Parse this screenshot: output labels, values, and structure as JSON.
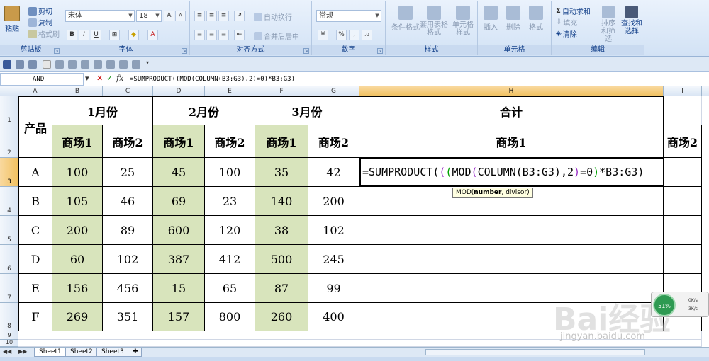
{
  "ribbon": {
    "groups": {
      "clipboard": "剪贴板",
      "font": "字体",
      "alignment": "对齐方式",
      "number": "数字",
      "styles": "样式",
      "cells": "单元格",
      "editing": "编辑"
    },
    "paste": "粘贴",
    "cut": "剪切",
    "copy": "复制",
    "format_painter": "格式刷",
    "font_name": "宋体",
    "font_size": "18",
    "wrap_text": "自动换行",
    "merge_center": "合并后居中",
    "number_format": "常规",
    "conditional_format": "条件格式",
    "format_table": "套用表格格式",
    "cell_styles": "单元格样式",
    "insert": "插入",
    "delete": "删除",
    "format": "格式",
    "autosum": "自动求和",
    "fill": "填充",
    "clear": "清除",
    "sort_filter": "排序和筛选",
    "find_select": "查找和选择"
  },
  "formula_bar": {
    "name_box": "AND",
    "formula": "=SUMPRODUCT((MOD(COLUMN(B3:G3),2)=0)*B3:G3)"
  },
  "columns": [
    "A",
    "B",
    "C",
    "D",
    "E",
    "F",
    "G",
    "H",
    "I"
  ],
  "rows": [
    "1",
    "2",
    "3",
    "4",
    "5",
    "6",
    "7",
    "8",
    "9",
    "10"
  ],
  "table": {
    "product_header": "产品",
    "months": [
      "1月份",
      "2月份",
      "3月份"
    ],
    "total_header": "合计",
    "store1": "商场1",
    "store2": "商场2",
    "total_store1": "商场1",
    "total_store2": "商场2",
    "data": [
      {
        "product": "A",
        "values": [
          "100",
          "25",
          "45",
          "100",
          "35",
          "42"
        ]
      },
      {
        "product": "B",
        "values": [
          "105",
          "46",
          "69",
          "23",
          "140",
          "200"
        ]
      },
      {
        "product": "C",
        "values": [
          "200",
          "89",
          "600",
          "120",
          "38",
          "102"
        ]
      },
      {
        "product": "D",
        "values": [
          "60",
          "102",
          "387",
          "412",
          "500",
          "245"
        ]
      },
      {
        "product": "E",
        "values": [
          "156",
          "456",
          "15",
          "65",
          "87",
          "99"
        ]
      },
      {
        "product": "F",
        "values": [
          "269",
          "351",
          "157",
          "800",
          "260",
          "400"
        ]
      }
    ]
  },
  "edit_cell": {
    "t1": "=SUMPRODUCT(",
    "t2": "(",
    "t3": "(",
    "t4": "MOD",
    "t5": "(",
    "t6": "COLUMN(B3:G3),2",
    "t7": ")",
    "t8": "=0",
    "t9": ")",
    "t10": "*B3:G3)"
  },
  "tooltip": {
    "fn": "MOD(",
    "arg": "number",
    "rest": ", divisor)"
  },
  "sheets": [
    "Sheet1",
    "Sheet2",
    "Sheet3"
  ],
  "network": {
    "percent": "51%",
    "up": "0K/s",
    "down": "3K/s"
  },
  "watermark": {
    "main": "Bai经验",
    "sub": "jingyan.baidu.com"
  }
}
